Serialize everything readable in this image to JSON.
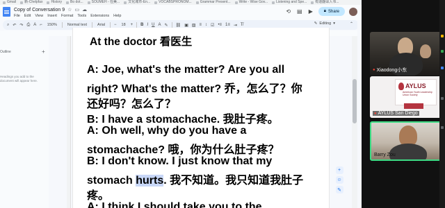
{
  "bookmarks": [
    "Gmail",
    "新-Chelpfax",
    "History",
    "Bo dot...",
    "SOUMEH - 在美...",
    "文化城市-En...",
    "VOCABSPRONOM...",
    "Grammar Present...",
    "Write - Wise Gov...",
    "Listening and Spe...",
    "有道翻译入书..."
  ],
  "docs": {
    "title": "Copy of Conversation 9",
    "menu": [
      "File",
      "Edit",
      "View",
      "Insert",
      "Format",
      "Tools",
      "Extensions",
      "Help"
    ],
    "share_label": "Share"
  },
  "toolbar": {
    "zoom": "150%",
    "style": "Normal text",
    "font": "Arial",
    "size": "18",
    "bold": "B",
    "italic": "I",
    "underline": "U",
    "mode": "Editing"
  },
  "outline": {
    "title": "Outline",
    "hint": "Headings you add to the document will appear here."
  },
  "document": {
    "heading": "At the doctor 看医生",
    "lines": [
      "A: Joe, what's the matter? Are you all",
      "right? What's the matter? 乔，怎么了？你",
      "还好吗？怎么了？",
      "B: I have a stomachache. 我肚子疼。",
      "A: Oh well, why do you have a",
      "stomachache? 哦，你为什么肚子疼？",
      "B: I don't know. I just know that my",
      "疼。",
      "A: I think I should take you to the"
    ],
    "line8_before": "stomach ",
    "line8_highlight": "hurts",
    "line8_after": ". 我不知道。我只知道我肚子"
  },
  "video": {
    "participants": [
      {
        "name": "Xiaodong小东"
      },
      {
        "name": "AYLUS San Diego"
      },
      {
        "name": "Barry Zou"
      }
    ],
    "slide": {
      "title": "AYLUS",
      "subtitle": "American Youth Leadership Union Society"
    }
  },
  "colors": {
    "share_bg": "#c2e7ff",
    "docs_blue": "#4285f4",
    "speaking_border": "#3ddc84",
    "highlight": "#c8d7f7"
  }
}
